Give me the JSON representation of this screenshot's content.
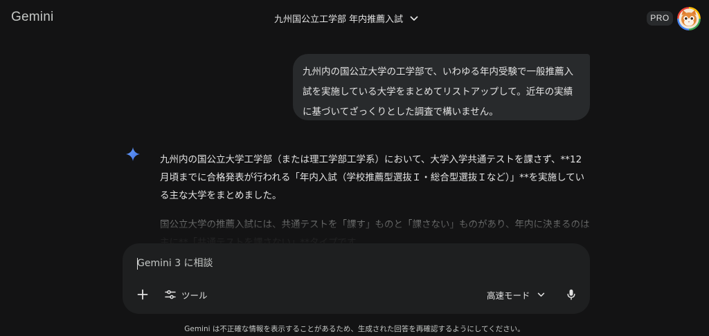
{
  "header": {
    "brand": "Gemini",
    "chat_title": "九州国公立工学部 年内推薦入試",
    "plan_badge": "PRO"
  },
  "conversation": {
    "user_message": "九州内の国公立大学の工学部で、いわゆる年内受験で一般推薦入試を実施している大学をまとめてリストアップして。近年の実績に基づいてざっくりとした調査で構いません。",
    "response_paragraphs": [
      "九州内の国公立大学工学部（または理工学部工学系）において、大学入学共通テストを課さず、**12月頃までに合格発表が行われる「年内入試（学校推薦型選抜Ｉ・総合型選抜Ｉなど）」**を実施している主な大学をまとめました。",
      "国公立大学の推薦入試には、共通テストを「課す」ものと「課さない」ものがあり、年内に決まるのは主に**「共通テストを課さない」**タイプです。"
    ]
  },
  "composer": {
    "placeholder": "Gemini 3 に相談",
    "value": "",
    "tools_label": "ツール",
    "mode_label": "高速モード"
  },
  "footer": {
    "disclaimer": "Gemini は不正確な情報を表示することがあるため、生成された回答を再確認するようにしてください。"
  },
  "icons": {
    "title_dropdown": "chevron-down-icon",
    "avatar": "cat-avatar-icon",
    "response": "gemini-spark-icon",
    "add": "plus-icon",
    "tools": "tune-icon",
    "mode_dropdown": "chevron-down-icon",
    "mic": "microphone-icon"
  },
  "colors": {
    "background": "#131314",
    "bubble": "#282a2c",
    "composer": "#1e1f20",
    "text": "#e3e3e3",
    "muted_text": "#c4c7c5",
    "spark_blue": "#4b8bf5"
  }
}
